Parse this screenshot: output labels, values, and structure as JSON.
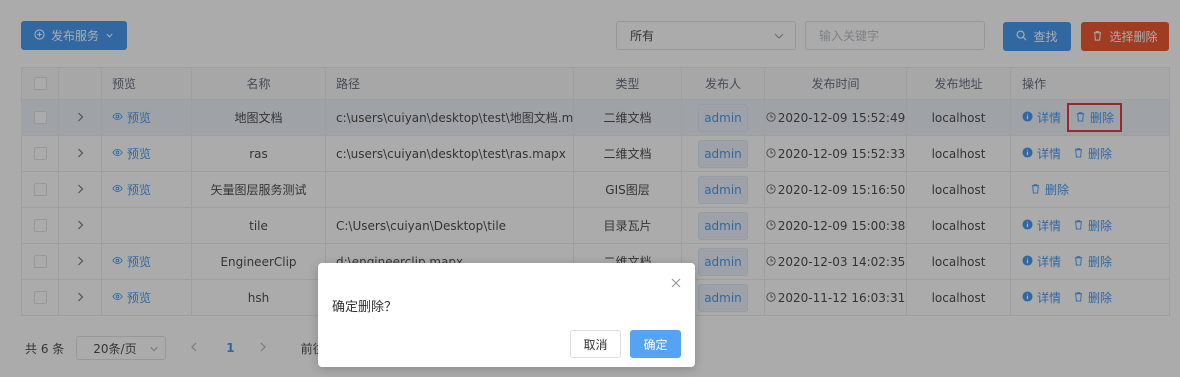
{
  "toolbar": {
    "publish_label": "发布服务",
    "filter_value": "所有",
    "keyword_placeholder": "输入关键字",
    "search_label": "查找",
    "delete_selected_label": "选择删除"
  },
  "table": {
    "headers": {
      "preview": "预览",
      "name": "名称",
      "path": "路径",
      "type": "类型",
      "publisher": "发布人",
      "time": "发布时间",
      "address": "发布地址",
      "actions": "操作"
    },
    "rows": [
      {
        "preview": "预览",
        "name": "地图文档",
        "path": "c:\\users\\cuiyan\\desktop\\test\\地图文档.mapx",
        "type": "二维文档",
        "publisher": "admin",
        "time": "2020-12-09 15:52:49",
        "address": "localhost",
        "detail": "详情",
        "delete": "删除"
      },
      {
        "preview": "预览",
        "name": "ras",
        "path": "c:\\users\\cuiyan\\desktop\\test\\ras.mapx",
        "type": "二维文档",
        "publisher": "admin",
        "time": "2020-12-09 15:52:33",
        "address": "localhost",
        "detail": "详情",
        "delete": "删除"
      },
      {
        "preview": "预览",
        "name": "矢量图层服务测试",
        "path": "",
        "type": "GIS图层",
        "publisher": "admin",
        "time": "2020-12-09 15:16:50",
        "address": "localhost",
        "detail": "",
        "delete": "删除"
      },
      {
        "preview": "",
        "name": "tile",
        "path": "C:\\Users\\cuiyan\\Desktop\\tile",
        "type": "目录瓦片",
        "publisher": "admin",
        "time": "2020-12-09 15:00:38",
        "address": "localhost",
        "detail": "详情",
        "delete": "删除"
      },
      {
        "preview": "预览",
        "name": "EngineerClip",
        "path": "d:\\engineerclip.mapx",
        "type": "二维文档",
        "publisher": "admin",
        "time": "2020-12-03 14:02:35",
        "address": "localhost",
        "detail": "详情",
        "delete": "删除"
      },
      {
        "preview": "预览",
        "name": "hsh",
        "path": "",
        "type": "",
        "publisher": "admin",
        "time": "2020-11-12 16:03:31",
        "address": "localhost",
        "detail": "详情",
        "delete": "删除"
      }
    ]
  },
  "pagination": {
    "total": "共 6 条",
    "page_size": "20条/页",
    "current_page": "1",
    "goto_label": "前往"
  },
  "dialog": {
    "message": "确定删除？",
    "cancel_label": "取消",
    "ok_label": "确定"
  },
  "colors": {
    "primary": "#2d8cf0",
    "danger": "#ed4014",
    "highlight_box": "#e02020"
  }
}
